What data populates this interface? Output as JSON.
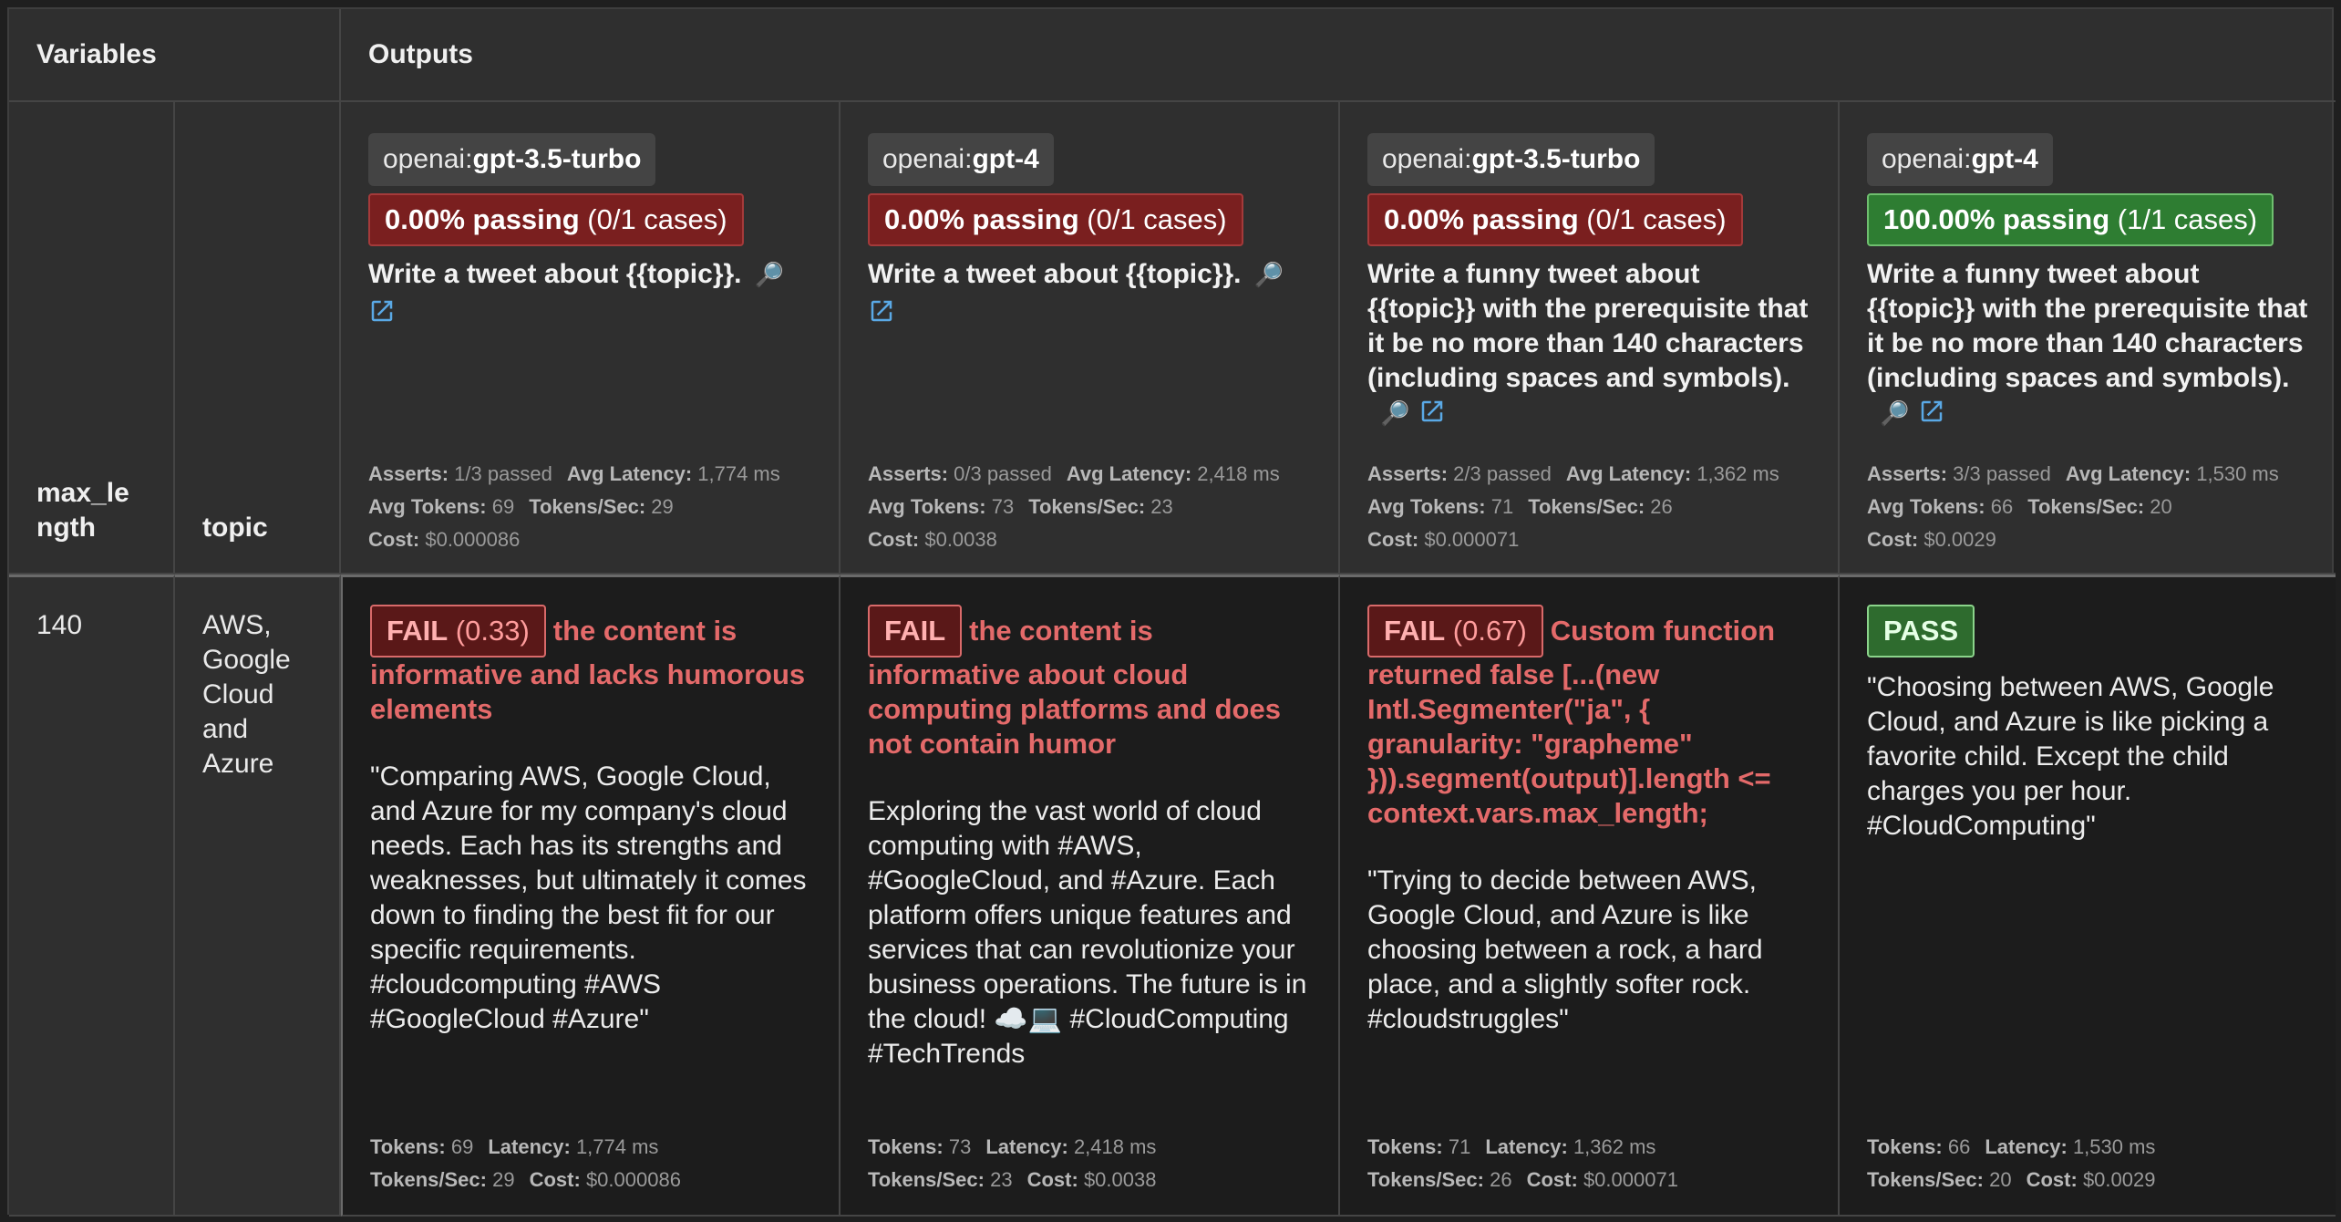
{
  "header": {
    "variables": "Variables",
    "outputs": "Outputs"
  },
  "var_columns": [
    "max_length",
    "topic"
  ],
  "row": {
    "max_length": "140",
    "topic": "AWS, Google Cloud and Azure"
  },
  "prompts": [
    {
      "provider_prefix": "openai:",
      "provider_model": "gpt-3.5-turbo",
      "pass_rate": "0.00% passing",
      "pass_cases": "(0/1 cases)",
      "status": "bad",
      "prompt": "Write a tweet about {{topic}}.",
      "asserts_label": "Asserts:",
      "asserts": "1/3 passed",
      "latency_label": "Avg Latency:",
      "latency": "1,774 ms",
      "tokens_label": "Avg Tokens:",
      "tokens": "69",
      "tps_label": "Tokens/Sec:",
      "tps": "29",
      "cost_label": "Cost:",
      "cost": "$0.000086"
    },
    {
      "provider_prefix": "openai:",
      "provider_model": "gpt-4",
      "pass_rate": "0.00% passing",
      "pass_cases": "(0/1 cases)",
      "status": "bad",
      "prompt": "Write a tweet about {{topic}}.",
      "asserts_label": "Asserts:",
      "asserts": "0/3 passed",
      "latency_label": "Avg Latency:",
      "latency": "2,418 ms",
      "tokens_label": "Avg Tokens:",
      "tokens": "73",
      "tps_label": "Tokens/Sec:",
      "tps": "23",
      "cost_label": "Cost:",
      "cost": "$0.0038"
    },
    {
      "provider_prefix": "openai:",
      "provider_model": "gpt-3.5-turbo",
      "pass_rate": "0.00% passing",
      "pass_cases": "(0/1 cases)",
      "status": "bad",
      "prompt": "Write a funny tweet about {{topic}} with the prerequisite that it be no more than 140 characters (including spaces and symbols).",
      "asserts_label": "Asserts:",
      "asserts": "2/3 passed",
      "latency_label": "Avg Latency:",
      "latency": "1,362 ms",
      "tokens_label": "Avg Tokens:",
      "tokens": "71",
      "tps_label": "Tokens/Sec:",
      "tps": "26",
      "cost_label": "Cost:",
      "cost": "$0.000071"
    },
    {
      "provider_prefix": "openai:",
      "provider_model": "gpt-4",
      "pass_rate": "100.00% passing",
      "pass_cases": "(1/1 cases)",
      "status": "good",
      "prompt": "Write a funny tweet about {{topic}} with the prerequisite that it be no more than 140 characters (including spaces and symbols).",
      "asserts_label": "Asserts:",
      "asserts": "3/3 passed",
      "latency_label": "Avg Latency:",
      "latency": "1,530 ms",
      "tokens_label": "Avg Tokens:",
      "tokens": "66",
      "tps_label": "Tokens/Sec:",
      "tps": "20",
      "cost_label": "Cost:",
      "cost": "$0.0029"
    }
  ],
  "outputs": [
    {
      "verdict": "FAIL",
      "score": "(0.33)",
      "reason": "the content is informative and lacks humorous elements",
      "text": "\"Comparing AWS, Google Cloud, and Azure for my company's cloud needs. Each has its strengths and weaknesses, but ultimately it comes down to finding the best fit for our specific requirements. #cloudcomputing #AWS #GoogleCloud #Azure\"",
      "tokens_label": "Tokens:",
      "tokens": "69",
      "latency_label": "Latency:",
      "latency": "1,774 ms",
      "tps_label": "Tokens/Sec:",
      "tps": "29",
      "cost_label": "Cost:",
      "cost": "$0.000086"
    },
    {
      "verdict": "FAIL",
      "score": "",
      "reason": "the content is informative about cloud computing platforms and does not contain humor",
      "text": "Exploring the vast world of cloud computing with #AWS, #GoogleCloud, and #Azure. Each platform offers unique features and services that can revolutionize your business operations. The future is in the cloud! ☁️💻 #CloudComputing #TechTrends",
      "tokens_label": "Tokens:",
      "tokens": "73",
      "latency_label": "Latency:",
      "latency": "2,418 ms",
      "tps_label": "Tokens/Sec:",
      "tps": "23",
      "cost_label": "Cost:",
      "cost": "$0.0038"
    },
    {
      "verdict": "FAIL",
      "score": "(0.67)",
      "reason": "Custom function returned false [...(new Intl.Segmenter(\"ja\", { granularity: \"grapheme\" })).segment(output)].length <= context.vars.max_length;",
      "text": "\"Trying to decide between AWS, Google Cloud, and Azure is like choosing between a rock, a hard place, and a slightly softer rock. #cloudstruggles\"",
      "tokens_label": "Tokens:",
      "tokens": "71",
      "latency_label": "Latency:",
      "latency": "1,362 ms",
      "tps_label": "Tokens/Sec:",
      "tps": "26",
      "cost_label": "Cost:",
      "cost": "$0.000071"
    },
    {
      "verdict": "PASS",
      "score": "",
      "reason": "",
      "text": "\"Choosing between AWS, Google Cloud, and Azure is like picking a favorite child. Except the child charges you per hour. #CloudComputing\"",
      "tokens_label": "Tokens:",
      "tokens": "66",
      "latency_label": "Latency:",
      "latency": "1,530 ms",
      "tps_label": "Tokens/Sec:",
      "tps": "20",
      "cost_label": "Cost:",
      "cost": "$0.0029"
    }
  ],
  "icons": {
    "inspect": "magnifier-icon",
    "open": "external-link-icon"
  }
}
